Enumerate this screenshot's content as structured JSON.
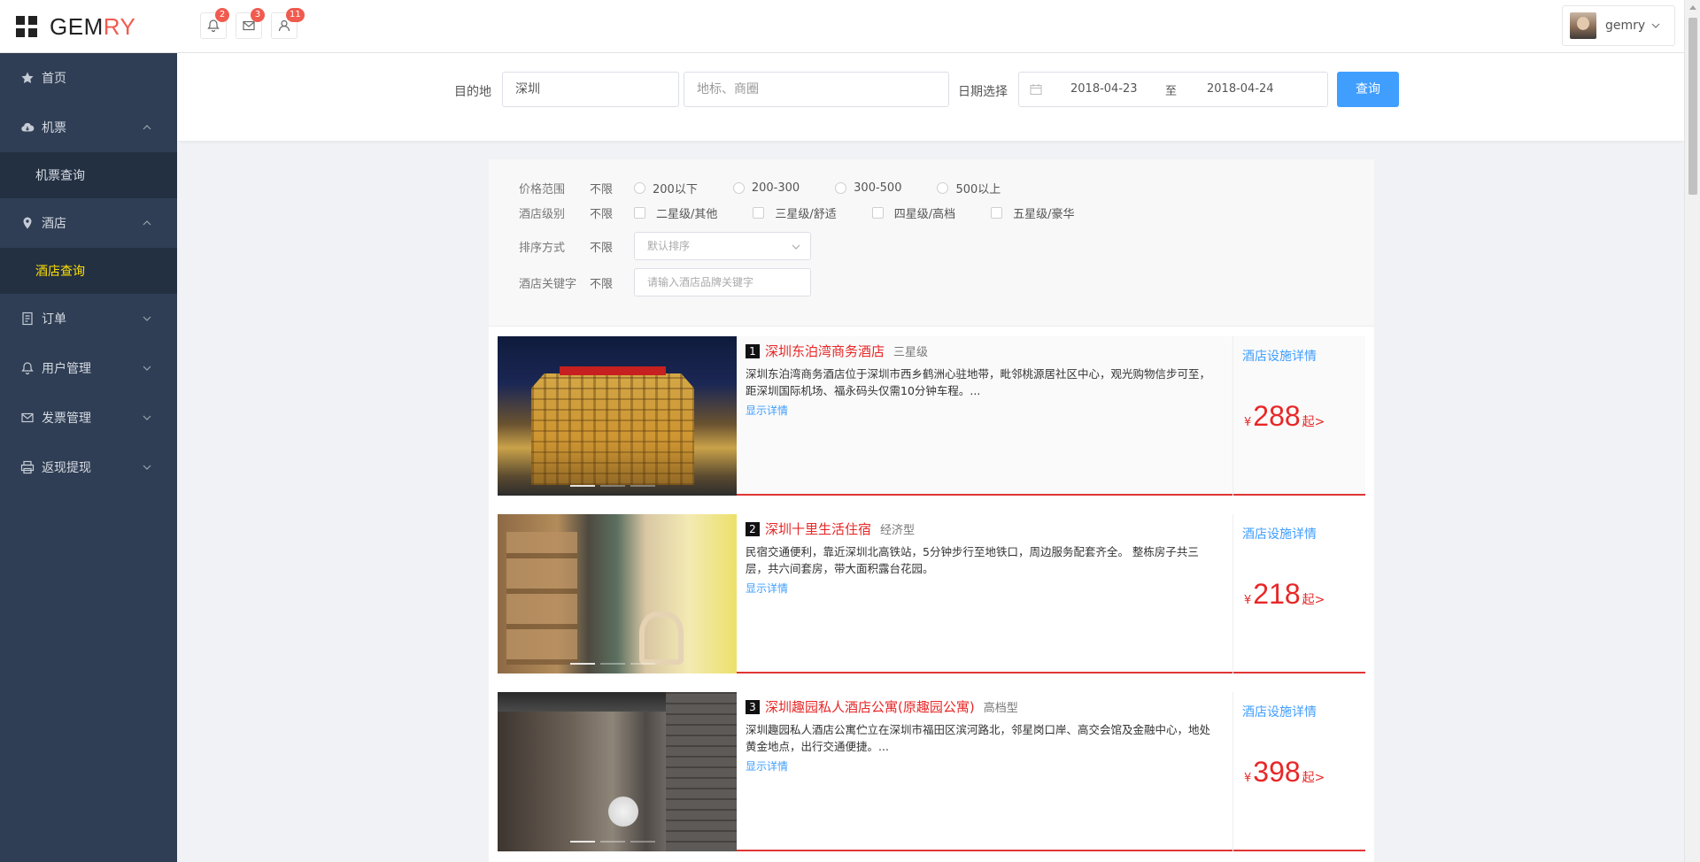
{
  "header": {
    "logo_main": "GEM",
    "logo_accent": "RY",
    "notifications": [
      {
        "icon": "bell-icon",
        "count": "2"
      },
      {
        "icon": "mail-icon",
        "count": "3"
      },
      {
        "icon": "user-icon",
        "count": "11"
      }
    ],
    "user_name": "gemry"
  },
  "sidebar": {
    "items": [
      {
        "label": "首页",
        "icon": "star-icon"
      },
      {
        "label": "机票",
        "icon": "cloud-icon",
        "sub": "机票查询"
      },
      {
        "label": "酒店",
        "icon": "location-icon",
        "sub": "酒店查询"
      },
      {
        "label": "订单",
        "icon": "document-icon"
      },
      {
        "label": "用户管理",
        "icon": "bell-icon"
      },
      {
        "label": "发票管理",
        "icon": "mail-icon"
      },
      {
        "label": "返现提现",
        "icon": "printer-icon"
      }
    ]
  },
  "search": {
    "destination_label": "目的地",
    "destination_value": "深圳",
    "landmark_placeholder": "地标、商圈",
    "date_label": "日期选择",
    "date_start": "2018-04-23",
    "date_sep": "至",
    "date_end": "2018-04-24",
    "query_button": "查询"
  },
  "filters": {
    "any": "不限",
    "price_label": "价格范围",
    "price_options": [
      "200以下",
      "200-300",
      "300-500",
      "500以上"
    ],
    "level_label": "酒店级别",
    "level_options": [
      "二星级/其他",
      "三星级/舒适",
      "四星级/高档",
      "五星级/豪华"
    ],
    "sort_label": "排序方式",
    "sort_value": "默认排序",
    "keyword_label": "酒店关键字",
    "keyword_placeholder": "请输入酒店品牌关键字"
  },
  "hotels": [
    {
      "num": "1",
      "name": "深圳东泊湾商务酒店",
      "level": "三星级",
      "desc": "深圳东泊湾商务酒店位于深圳市西乡鹤洲心驻地带，毗邻桃源居社区中心，观光购物信步可至，距深圳国际机场、福永码头仅需10分钟车程。...",
      "more": "显示详情",
      "detail_link": "酒店设施详情",
      "currency": "¥",
      "price": "288",
      "from": "起>"
    },
    {
      "num": "2",
      "name": "深圳十里生活住宿",
      "level": "经济型",
      "desc": "民宿交通便利，靠近深圳北高铁站，5分钟步行至地铁口，周边服务配套齐全。 整栋房子共三层，共六间套房，带大面积露台花园。",
      "more": "显示详情",
      "detail_link": "酒店设施详情",
      "currency": "¥",
      "price": "218",
      "from": "起>"
    },
    {
      "num": "3",
      "name": "深圳趣园私人酒店公寓(原趣园公寓)",
      "level": "高档型",
      "desc": "深圳趣园私人酒店公寓伫立在深圳市福田区滨河路北，邻星岗口岸、高交会馆及金融中心，地处黄金地点，出行交通便捷。...",
      "more": "显示详情",
      "detail_link": "酒店设施详情",
      "currency": "¥",
      "price": "398",
      "from": "起>"
    }
  ]
}
